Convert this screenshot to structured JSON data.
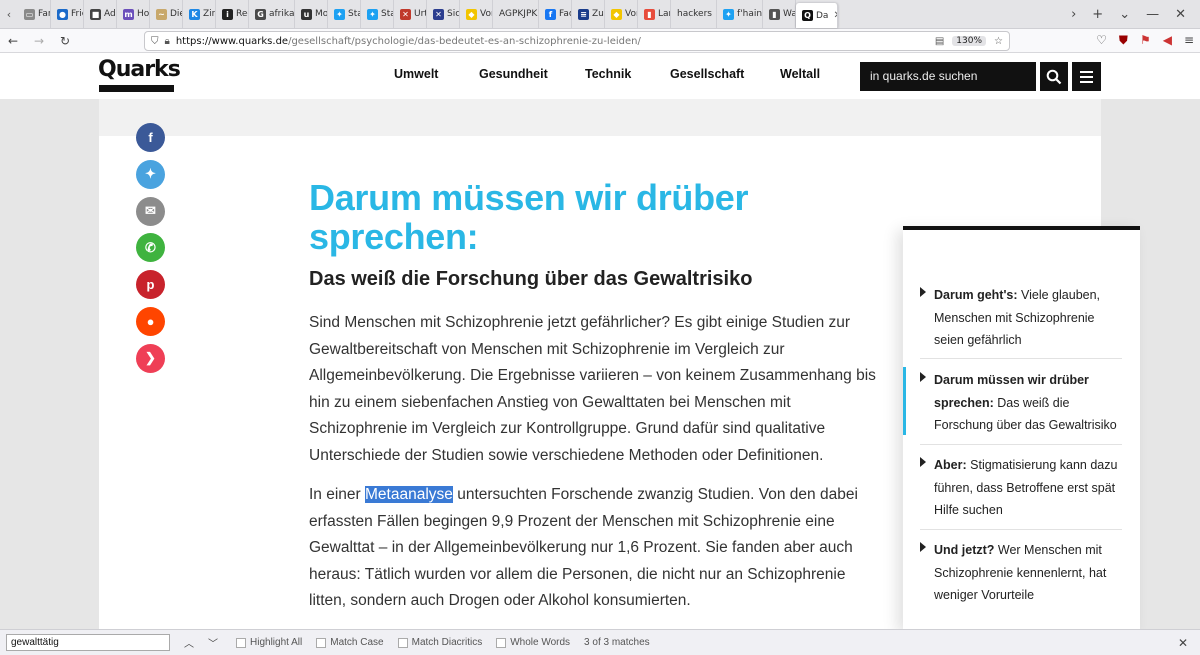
{
  "browser": {
    "tabs": [
      {
        "label": "Fan",
        "color": "#8a8a8a",
        "glyph": "▭"
      },
      {
        "label": "Frie",
        "color": "#1b6ac9",
        "glyph": "●"
      },
      {
        "label": "Adre",
        "color": "#444444",
        "glyph": "■"
      },
      {
        "label": "Hom",
        "color": "#6b4fbb",
        "glyph": "m"
      },
      {
        "label": "Die Z",
        "color": "#c8a86b",
        "glyph": "~"
      },
      {
        "label": "Zirbe",
        "color": "#1e88e5",
        "glyph": "K"
      },
      {
        "label": "Rech",
        "color": "#222222",
        "glyph": "i"
      },
      {
        "label": "afrika",
        "color": "#4a4a4a",
        "glyph": "G"
      },
      {
        "label": "Mont",
        "color": "#333333",
        "glyph": "u"
      },
      {
        "label": "Start",
        "color": "#1da1f2",
        "glyph": "✦"
      },
      {
        "label": "Start",
        "color": "#1da1f2",
        "glyph": "✦"
      },
      {
        "label": "Urtei",
        "color": "#c0392b",
        "glyph": "✕"
      },
      {
        "label": "Siche",
        "color": "#2c3e8f",
        "glyph": "✕"
      },
      {
        "label": "Vorla",
        "color": "#f2c500",
        "glyph": "◆"
      },
      {
        "label": "AGPKJPK",
        "color": "#ffffff",
        "glyph": ""
      },
      {
        "label": "Faceb",
        "color": "#1877f2",
        "glyph": "f"
      },
      {
        "label": "Zusa",
        "color": "#1a3c8b",
        "glyph": "≡"
      },
      {
        "label": "Vorla",
        "color": "#f2c500",
        "glyph": "◆"
      },
      {
        "label": "Land",
        "color": "#e74c3c",
        "glyph": "▮"
      },
      {
        "label": "hackers",
        "color": "#ffffff",
        "glyph": ""
      },
      {
        "label": "f'hain",
        "color": "#1da1f2",
        "glyph": "✦"
      },
      {
        "label": "Way",
        "color": "#555555",
        "glyph": "▮"
      }
    ],
    "active_tab": {
      "label": "Da",
      "glyph": "Q"
    },
    "url_host": "https://www.quarks.de",
    "url_path": "/gesellschaft/psychologie/das-bedeutet-es-an-schizophrenie-zu-leiden/",
    "zoom": "130%"
  },
  "site": {
    "logo": "Quarks",
    "nav": [
      "Umwelt",
      "Gesundheit",
      "Technik",
      "Gesellschaft",
      "Weltall"
    ],
    "search_placeholder": "in quarks.de suchen"
  },
  "share": [
    {
      "name": "facebook",
      "color": "#3b5998",
      "glyph": "f"
    },
    {
      "name": "twitter",
      "color": "#4aa3df",
      "glyph": "✦"
    },
    {
      "name": "email",
      "color": "#8c8c8c",
      "glyph": "✉"
    },
    {
      "name": "whatsapp",
      "color": "#3fb33f",
      "glyph": "✆"
    },
    {
      "name": "pinterest",
      "color": "#c8232c",
      "glyph": "p"
    },
    {
      "name": "reddit",
      "color": "#ff4500",
      "glyph": "●"
    },
    {
      "name": "pocket",
      "color": "#ef3f56",
      "glyph": "❯"
    }
  ],
  "article": {
    "headline": "Darum müssen wir drüber sprechen:",
    "subhead": "Das weiß die Forschung über das Gewaltrisiko",
    "paragraph1": "Sind Menschen mit Schizophrenie jetzt gefährlicher? Es gibt einige Studien zur Gewaltbereitschaft von Menschen mit Schizophrenie im Vergleich zur Allgemeinbevölkerung. Die Ergebnisse variieren – von keinem Zusammenhang bis hin zu einem siebenfachen Anstieg von Gewalttaten bei Menschen mit Schizophrenie im Vergleich zur Kontrollgruppe. Grund dafür sind qualitative Unterschiede der Studien sowie verschiedene Methoden oder Definitionen.",
    "paragraph2_pre": "In einer ",
    "paragraph2_link": "Metaanalyse",
    "paragraph2_post": " untersuchten Forschende zwanzig Studien. Von den dabei erfassten Fällen begingen 9,9 Prozent der Menschen mit Schizophrenie eine Gewalttat – in der Allgemeinbevölkerung nur 1,6 Prozent. Sie fanden aber auch heraus: Tätlich wurden vor allem die Personen, die nicht nur an Schizophrenie litten, sondern auch Drogen oder Alkohol konsumierten."
  },
  "toc": [
    {
      "bold": "Darum geht's:",
      "text": " Viele glauben, Menschen mit Schizophrenie seien gefährlich"
    },
    {
      "bold": "Darum müssen wir drüber sprechen:",
      "text": " Das weiß die Forschung über das Gewaltrisiko"
    },
    {
      "bold": "Aber:",
      "text": " Stigmatisierung kann dazu führen, dass Betroffene erst spät Hilfe suchen"
    },
    {
      "bold": "Und jetzt?",
      "text": " Wer Menschen mit Schizophrenie kennenlernt, hat weniger Vorurteile"
    }
  ],
  "findbar": {
    "query": "gewalttätig",
    "highlight_all": "Highlight All",
    "match_case": "Match Case",
    "match_diacritics": "Match Diacritics",
    "whole_words": "Whole Words",
    "status": "3 of 3 matches"
  },
  "colors": {
    "accent": "#2ab7e5",
    "selection": "#3a7ad5"
  }
}
